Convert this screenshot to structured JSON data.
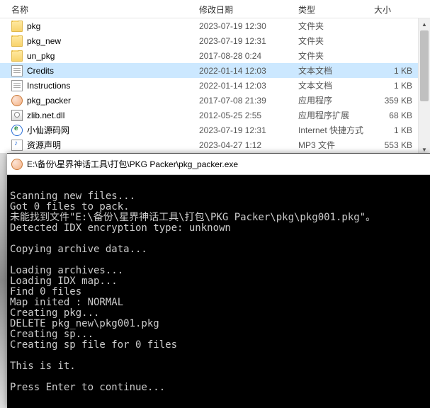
{
  "columns": {
    "name": "名称",
    "date": "修改日期",
    "type": "类型",
    "size": "大小"
  },
  "files": [
    {
      "icon": "folder",
      "name": "pkg",
      "date": "2023-07-19 12:30",
      "type": "文件夹",
      "size": ""
    },
    {
      "icon": "folder",
      "name": "pkg_new",
      "date": "2023-07-19 12:31",
      "type": "文件夹",
      "size": ""
    },
    {
      "icon": "folder",
      "name": "un_pkg",
      "date": "2017-08-28 0:24",
      "type": "文件夹",
      "size": ""
    },
    {
      "icon": "text",
      "name": "Credits",
      "date": "2022-01-14 12:03",
      "type": "文本文档",
      "size": "1 KB",
      "selected": true
    },
    {
      "icon": "text",
      "name": "Instructions",
      "date": "2022-01-14 12:03",
      "type": "文本文档",
      "size": "1 KB"
    },
    {
      "icon": "exe",
      "name": "pkg_packer",
      "date": "2017-07-08 21:39",
      "type": "应用程序",
      "size": "359 KB"
    },
    {
      "icon": "dll",
      "name": "zlib.net.dll",
      "date": "2012-05-25 2:55",
      "type": "应用程序扩展",
      "size": "68 KB"
    },
    {
      "icon": "link",
      "name": "小仙源码网",
      "date": "2023-07-19 12:31",
      "type": "Internet 快捷方式",
      "size": "1 KB"
    },
    {
      "icon": "mp3",
      "name": "资源声明",
      "date": "2023-04-27 1:12",
      "type": "MP3 文件",
      "size": "553 KB"
    }
  ],
  "console": {
    "title": "E:\\备份\\星界神话工具\\打包\\PKG Packer\\pkg_packer.exe",
    "lines": [
      "",
      "Scanning new files...",
      "Got 0 files to pack.",
      "未能找到文件\"E:\\备份\\星界神话工具\\打包\\PKG Packer\\pkg\\pkg001.pkg\"。",
      "Detected IDX encryption type: unknown",
      "",
      "Copying archive data...",
      "",
      "Loading archives...",
      "Loading IDX map...",
      "Find 0 files",
      "Map inited : NORMAL",
      "Creating pkg...",
      "DELETE pkg_new\\pkg001.pkg",
      "Creating sp...",
      "Creating sp file for 0 files",
      "",
      "This is it.",
      "",
      "Press Enter to continue..."
    ]
  }
}
